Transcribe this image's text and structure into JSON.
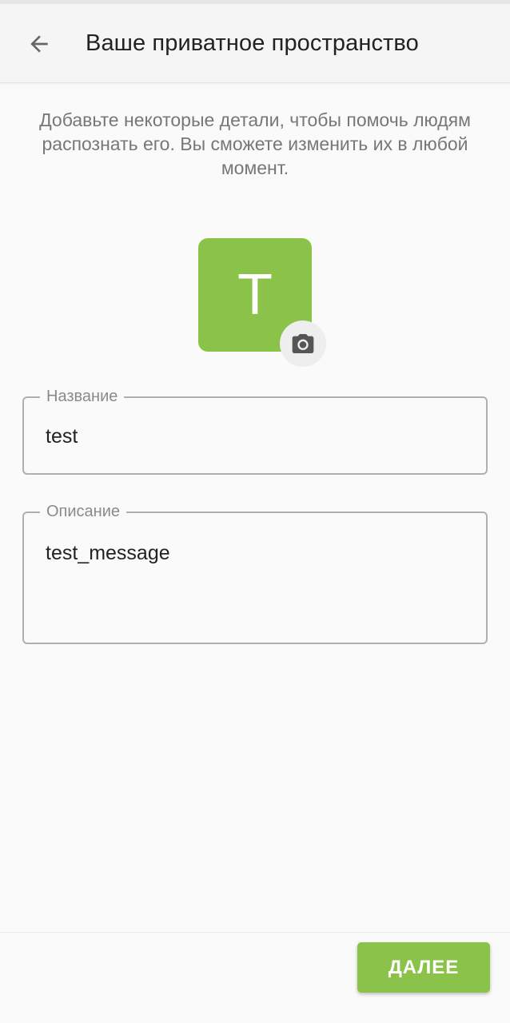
{
  "app_bar": {
    "title": "Ваше приватное пространство",
    "back_icon": "arrow-back-icon"
  },
  "intro_text": "Добавьте некоторые детали, чтобы помочь людям распознать его. Вы сможете изменить их в любой момент.",
  "avatar": {
    "letter": "T",
    "color": "#8bc34a",
    "camera_icon": "camera-icon"
  },
  "fields": {
    "name": {
      "label": "Название",
      "value": "test"
    },
    "description": {
      "label": "Описание",
      "value": "test_message"
    }
  },
  "next_button": {
    "label": "ДАЛЕЕ",
    "color": "#8bc34a"
  }
}
